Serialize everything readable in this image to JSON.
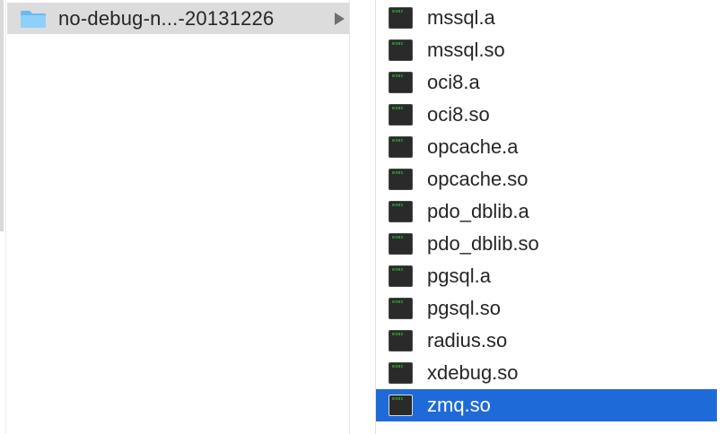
{
  "folder_column": {
    "folder": {
      "label": "no-debug-n...-20131226",
      "icon": "folder-icon",
      "color": "#7fc4f4",
      "has_children": true
    }
  },
  "file_column": {
    "icon": "executable-icon",
    "icon_text": "exec",
    "selected_index": 12,
    "selection_color": "#1f6ad9",
    "files": [
      {
        "name": "mssql.a"
      },
      {
        "name": "mssql.so"
      },
      {
        "name": "oci8.a"
      },
      {
        "name": "oci8.so"
      },
      {
        "name": "opcache.a"
      },
      {
        "name": "opcache.so"
      },
      {
        "name": "pdo_dblib.a"
      },
      {
        "name": "pdo_dblib.so"
      },
      {
        "name": "pgsql.a"
      },
      {
        "name": "pgsql.so"
      },
      {
        "name": "radius.so"
      },
      {
        "name": "xdebug.so"
      },
      {
        "name": "zmq.so"
      }
    ]
  }
}
